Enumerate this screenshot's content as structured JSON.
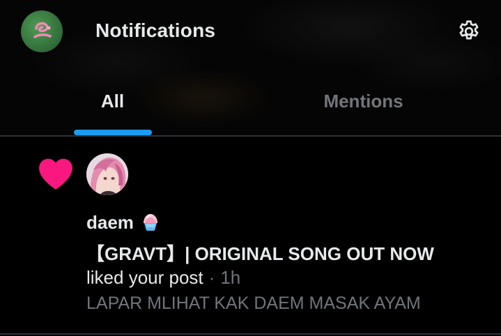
{
  "header": {
    "title": "Notifications",
    "settings_icon": "gear-icon",
    "profile_avatar_icon": "avatar"
  },
  "tabs": [
    {
      "label": "All",
      "selected": true
    },
    {
      "label": "Mentions",
      "selected": false
    }
  ],
  "colors": {
    "accent": "#1d9bf0",
    "like": "#f91880",
    "text_primary": "#e7e9ea",
    "text_secondary": "#71767b",
    "background": "#000000"
  },
  "notifications": [
    {
      "type_icon": "heart-icon",
      "actor_name": "daem",
      "actor_emoji": "shaved-ice-emoji",
      "post_title": "【GRAVT】| ORIGINAL SONG OUT NOW",
      "action": "liked your post",
      "separator": "·",
      "time": "1h",
      "excerpt": "LAPAR MLIHAT KAK DAEM MASAK AYAM"
    }
  ]
}
